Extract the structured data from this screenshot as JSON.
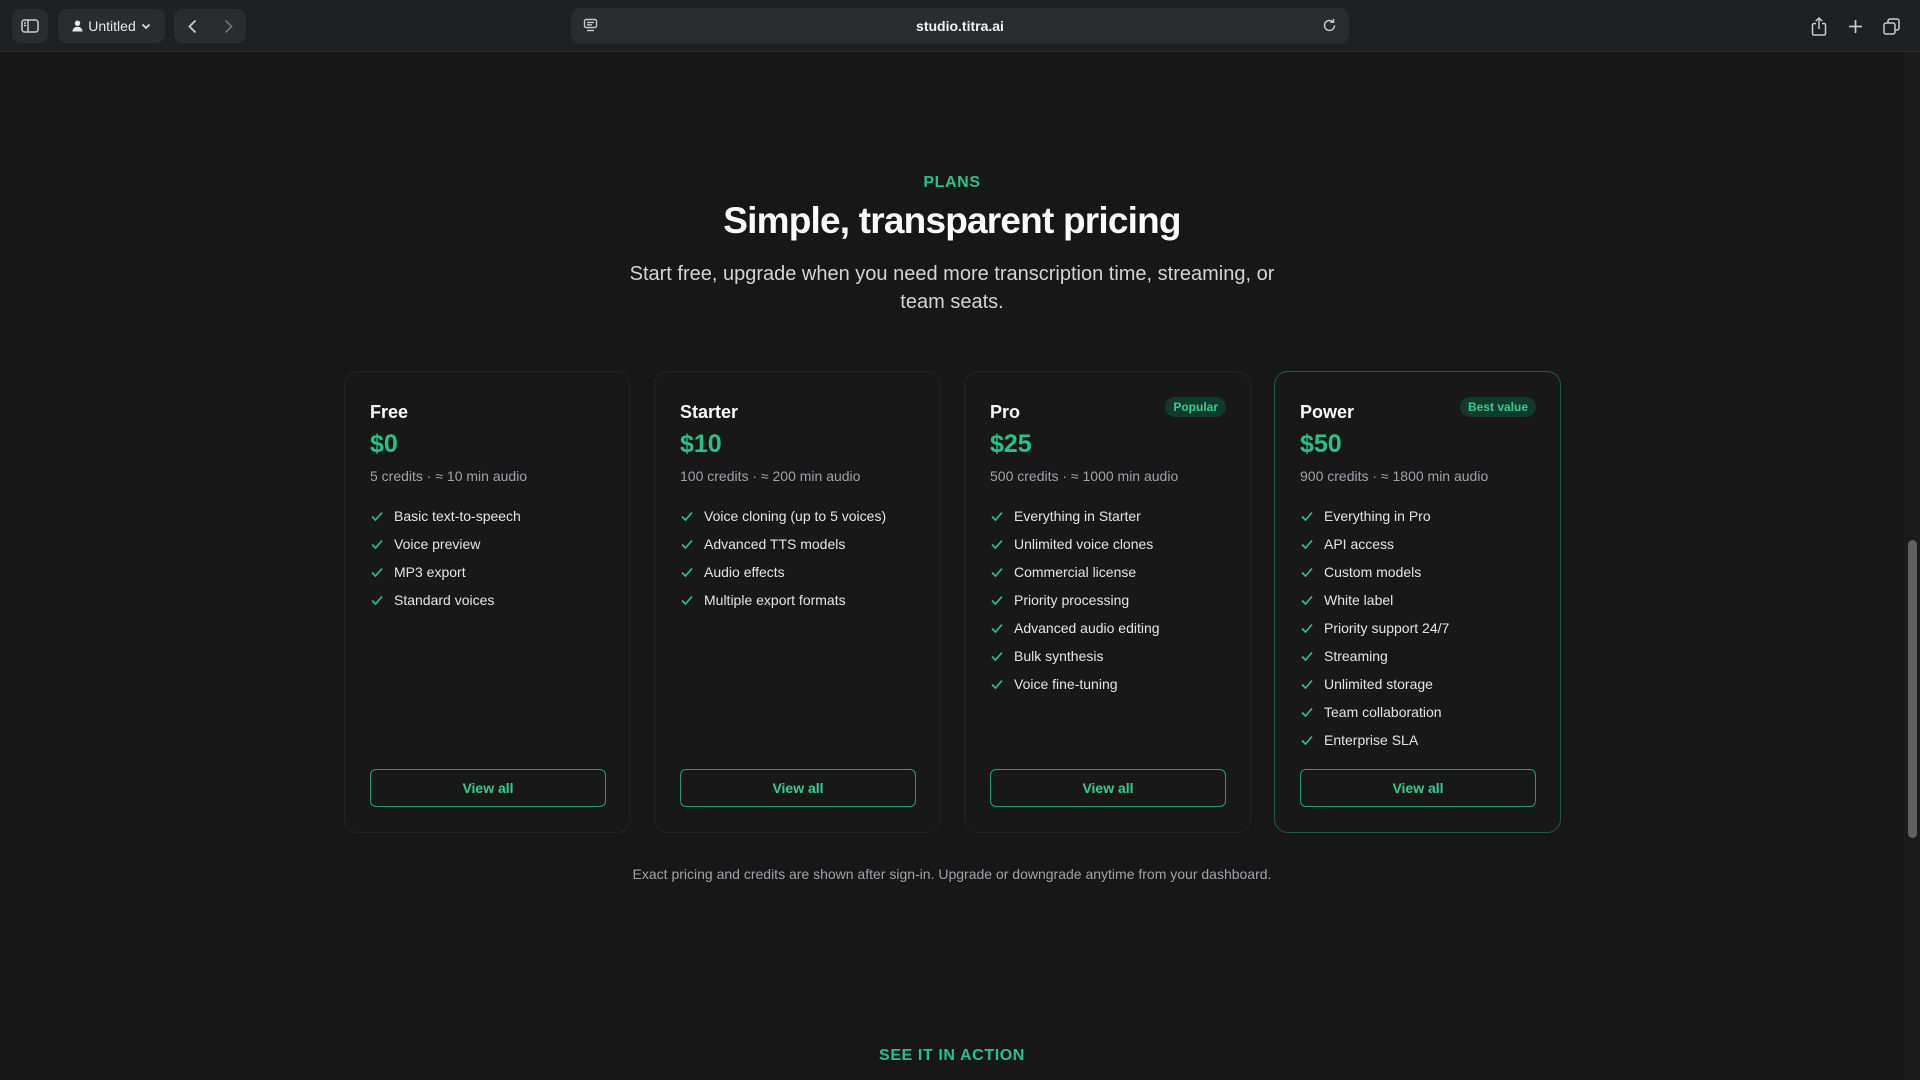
{
  "browser": {
    "profile_label": "Untitled",
    "url": "studio.titra.ai"
  },
  "hero": {
    "eyebrow": "PLANS",
    "title": "Simple, transparent pricing",
    "subtitle": "Start free, upgrade when you need more transcription time, streaming, or team seats."
  },
  "plans": [
    {
      "name": "Free",
      "badge": "",
      "price": "$0",
      "credits": "5 credits · ≈ 10 min audio",
      "features": [
        "Basic text-to-speech",
        "Voice preview",
        "MP3 export",
        "Standard voices"
      ],
      "button": "View all"
    },
    {
      "name": "Starter",
      "badge": "",
      "price": "$10",
      "credits": "100 credits · ≈ 200 min audio",
      "features": [
        "Voice cloning (up to 5 voices)",
        "Advanced TTS models",
        "Audio effects",
        "Multiple export formats"
      ],
      "button": "View all"
    },
    {
      "name": "Pro",
      "badge": "Popular",
      "price": "$25",
      "credits": "500 credits · ≈ 1000 min audio",
      "features": [
        "Everything in Starter",
        "Unlimited voice clones",
        "Commercial license",
        "Priority processing",
        "Advanced audio editing",
        "Bulk synthesis",
        "Voice fine-tuning"
      ],
      "button": "View all"
    },
    {
      "name": "Power",
      "badge": "Best value",
      "price": "$50",
      "credits": "900 credits · ≈ 1800 min audio",
      "features": [
        "Everything in Pro",
        "API access",
        "Custom models",
        "White label",
        "Priority support 24/7",
        "Streaming",
        "Unlimited storage",
        "Team collaboration",
        "Enterprise SLA"
      ],
      "button": "View all"
    }
  ],
  "footnote": "Exact pricing and credits are shown after sign-in. Upgrade or downgrade anytime from your dashboard.",
  "next_section_eyebrow": "SEE IT IN ACTION",
  "colors": {
    "accent": "#23c487",
    "background": "#171717",
    "card_highlight_border": "#1d5b45"
  }
}
